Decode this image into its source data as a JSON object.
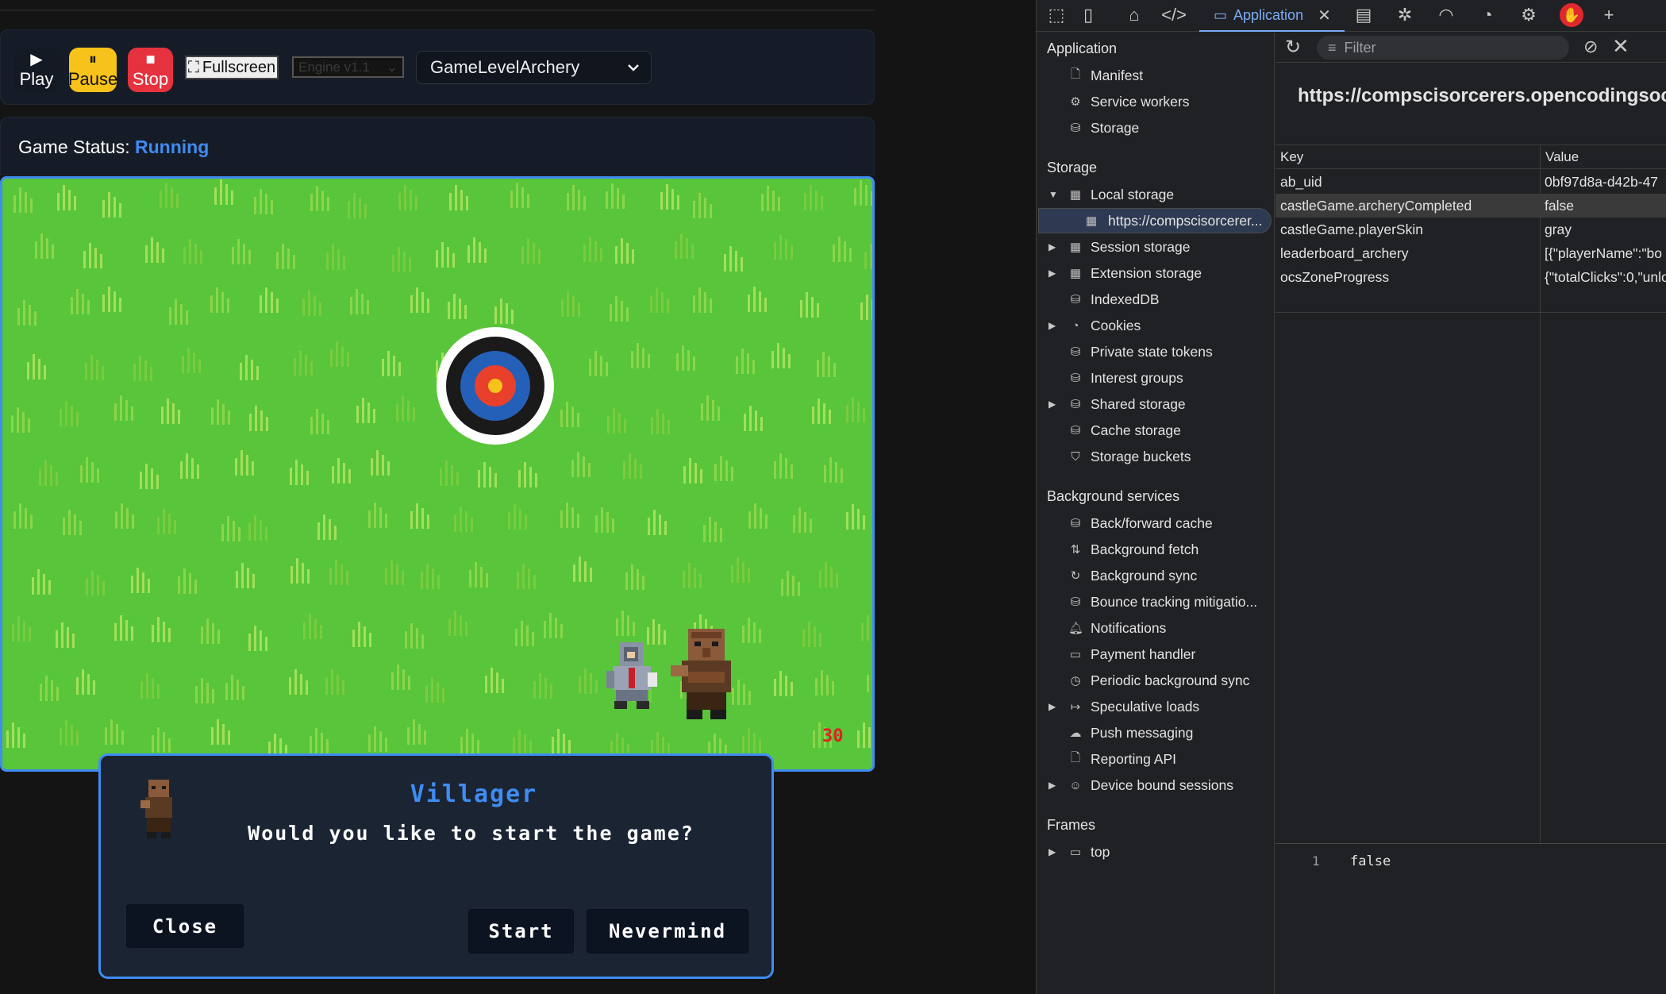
{
  "toolbar": {
    "play_label": "Play",
    "pause_label": "Pause",
    "stop_label": "Stop",
    "fullscreen_label": "Fullscreen",
    "engine_value": "Engine v1.1",
    "level_value": "GameLevelArchery"
  },
  "status": {
    "label": "Game Status:",
    "value": "Running"
  },
  "game": {
    "score": "30"
  },
  "dialog": {
    "name": "Villager",
    "message": "Would you like to start the game?",
    "close_label": "Close",
    "start_label": "Start",
    "nevermind_label": "Nevermind"
  },
  "devtools": {
    "active_tab": "Application",
    "sidebar": {
      "application_title": "Application",
      "application_items": [
        "Manifest",
        "Service workers",
        "Storage"
      ],
      "storage_title": "Storage",
      "storage_items": [
        "Local storage",
        "https://compscisorcerer...",
        "Session storage",
        "Extension storage",
        "IndexedDB",
        "Cookies",
        "Private state tokens",
        "Interest groups",
        "Shared storage",
        "Cache storage",
        "Storage buckets"
      ],
      "background_title": "Background services",
      "background_items": [
        "Back/forward cache",
        "Background fetch",
        "Background sync",
        "Bounce tracking mitigatio...",
        "Notifications",
        "Payment handler",
        "Periodic background sync",
        "Speculative loads",
        "Push messaging",
        "Reporting API",
        "Device bound sessions"
      ],
      "frames_title": "Frames",
      "frames_items": [
        "top"
      ]
    },
    "filter_placeholder": "Filter",
    "origin_url": "https://compscisorcerers.opencodingsociety",
    "table": {
      "headers": [
        "Key",
        "Value"
      ],
      "rows": [
        {
          "key": "ab_uid",
          "value": "0bf97d8a-d42b-47"
        },
        {
          "key": "castleGame.archeryCompleted",
          "value": "false"
        },
        {
          "key": "castleGame.playerSkin",
          "value": "gray"
        },
        {
          "key": "leaderboard_archery",
          "value": "[{\"playerName\":\"bo"
        },
        {
          "key": "ocsZoneProgress",
          "value": "{\"totalClicks\":0,\"unlo"
        }
      ]
    },
    "preview": {
      "line": "1",
      "value": "false"
    }
  }
}
